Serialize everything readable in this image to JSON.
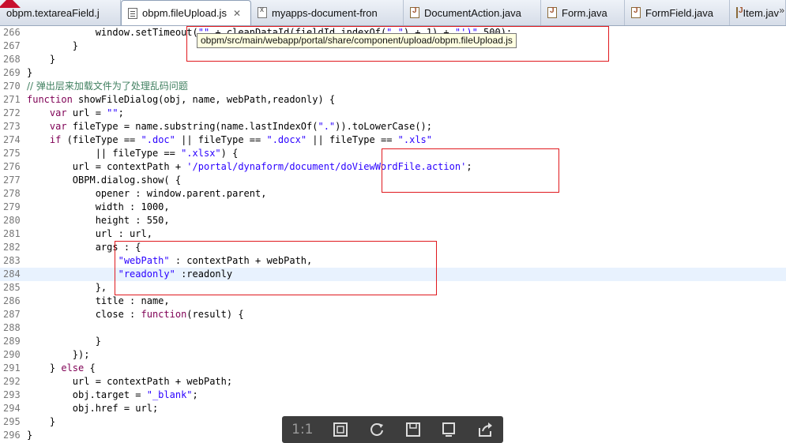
{
  "tabs": [
    {
      "label": "obpm.textareaField.j",
      "icon": "js-file-icon",
      "active": false
    },
    {
      "label": "obpm.fileUpload.js",
      "icon": "js-file-icon",
      "active": true
    },
    {
      "label": "myapps-document-fron",
      "icon": "xml-file-icon",
      "active": false
    },
    {
      "label": "DocumentAction.java",
      "icon": "java-file-icon",
      "active": false
    },
    {
      "label": "Form.java",
      "icon": "java-file-icon",
      "active": false
    },
    {
      "label": "FormField.java",
      "icon": "java-file-icon",
      "active": false
    },
    {
      "label": "Item.jav",
      "icon": "java-file-icon",
      "active": false
    }
  ],
  "tab_close_glyph": "✕",
  "overflow_glyph": "»",
  "tooltip": "obpm/src/main/webapp/portal/share/component/upload/obpm.fileUpload.js",
  "code_lines": [
    {
      "n": "266",
      "text": "            window.setTimeout(\"\" + cleanDataId(fieldId.indexOf(\"_\") + 1) + \"')\",500);"
    },
    {
      "n": "267",
      "text": "        }"
    },
    {
      "n": "268",
      "text": "    }"
    },
    {
      "n": "269",
      "text": "}"
    },
    {
      "n": "270",
      "text": "// 弹出层来加载文件为了处理乱码问题"
    },
    {
      "n": "271",
      "text": "function showFileDialog(obj, name, webPath,readonly) {"
    },
    {
      "n": "272",
      "text": "    var url = \"\";"
    },
    {
      "n": "273",
      "text": "    var fileType = name.substring(name.lastIndexOf(\".\")).toLowerCase();"
    },
    {
      "n": "274",
      "text": "    if (fileType == \".doc\" || fileType == \".docx\" || fileType == \".xls\""
    },
    {
      "n": "275",
      "text": "            || fileType == \".xlsx\") {"
    },
    {
      "n": "276",
      "text": "        url = contextPath + '/portal/dynaform/document/doViewWordFile.action';"
    },
    {
      "n": "277",
      "text": "        OBPM.dialog.show( {"
    },
    {
      "n": "278",
      "text": "            opener : window.parent.parent,"
    },
    {
      "n": "279",
      "text": "            width : 1000,"
    },
    {
      "n": "280",
      "text": "            height : 550,"
    },
    {
      "n": "281",
      "text": "            url : url,"
    },
    {
      "n": "282",
      "text": "            args : {"
    },
    {
      "n": "283",
      "text": "                \"webPath\" : contextPath + webPath,"
    },
    {
      "n": "284",
      "text": "                \"readonly\" :readonly"
    },
    {
      "n": "285",
      "text": "            },"
    },
    {
      "n": "286",
      "text": "            title : name,"
    },
    {
      "n": "287",
      "text": "            close : function(result) {"
    },
    {
      "n": "288",
      "text": ""
    },
    {
      "n": "289",
      "text": "            }"
    },
    {
      "n": "290",
      "text": "        });"
    },
    {
      "n": "291",
      "text": "    } else {"
    },
    {
      "n": "292",
      "text": "        url = contextPath + webPath;"
    },
    {
      "n": "293",
      "text": "        obj.target = \"_blank\";"
    },
    {
      "n": "294",
      "text": "        obj.href = url;"
    },
    {
      "n": "295",
      "text": "    }"
    },
    {
      "n": "296",
      "text": "}"
    }
  ],
  "viewer_toolbar": {
    "actual_size_label": "1:1",
    "buttons": [
      "actual-size",
      "fit-screen-icon",
      "rotate-icon",
      "save-icon",
      "copy-icon",
      "share-icon"
    ]
  },
  "colors": {
    "keyword": "#7f0055",
    "string": "#2a00ff",
    "comment": "#3f7f5f",
    "highlight_box": "#e0191e",
    "current_line": "#e8f2fe"
  }
}
